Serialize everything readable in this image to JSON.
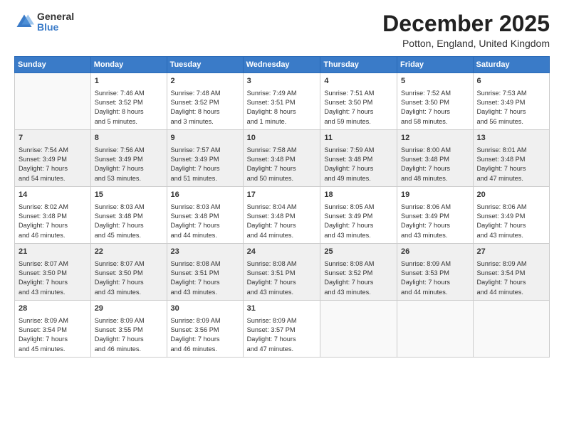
{
  "logo": {
    "general": "General",
    "blue": "Blue"
  },
  "title": "December 2025",
  "location": "Potton, England, United Kingdom",
  "headers": [
    "Sunday",
    "Monday",
    "Tuesday",
    "Wednesday",
    "Thursday",
    "Friday",
    "Saturday"
  ],
  "weeks": [
    [
      {
        "day": "",
        "info": ""
      },
      {
        "day": "1",
        "info": "Sunrise: 7:46 AM\nSunset: 3:52 PM\nDaylight: 8 hours\nand 5 minutes."
      },
      {
        "day": "2",
        "info": "Sunrise: 7:48 AM\nSunset: 3:52 PM\nDaylight: 8 hours\nand 3 minutes."
      },
      {
        "day": "3",
        "info": "Sunrise: 7:49 AM\nSunset: 3:51 PM\nDaylight: 8 hours\nand 1 minute."
      },
      {
        "day": "4",
        "info": "Sunrise: 7:51 AM\nSunset: 3:50 PM\nDaylight: 7 hours\nand 59 minutes."
      },
      {
        "day": "5",
        "info": "Sunrise: 7:52 AM\nSunset: 3:50 PM\nDaylight: 7 hours\nand 58 minutes."
      },
      {
        "day": "6",
        "info": "Sunrise: 7:53 AM\nSunset: 3:49 PM\nDaylight: 7 hours\nand 56 minutes."
      }
    ],
    [
      {
        "day": "7",
        "info": "Sunrise: 7:54 AM\nSunset: 3:49 PM\nDaylight: 7 hours\nand 54 minutes."
      },
      {
        "day": "8",
        "info": "Sunrise: 7:56 AM\nSunset: 3:49 PM\nDaylight: 7 hours\nand 53 minutes."
      },
      {
        "day": "9",
        "info": "Sunrise: 7:57 AM\nSunset: 3:49 PM\nDaylight: 7 hours\nand 51 minutes."
      },
      {
        "day": "10",
        "info": "Sunrise: 7:58 AM\nSunset: 3:48 PM\nDaylight: 7 hours\nand 50 minutes."
      },
      {
        "day": "11",
        "info": "Sunrise: 7:59 AM\nSunset: 3:48 PM\nDaylight: 7 hours\nand 49 minutes."
      },
      {
        "day": "12",
        "info": "Sunrise: 8:00 AM\nSunset: 3:48 PM\nDaylight: 7 hours\nand 48 minutes."
      },
      {
        "day": "13",
        "info": "Sunrise: 8:01 AM\nSunset: 3:48 PM\nDaylight: 7 hours\nand 47 minutes."
      }
    ],
    [
      {
        "day": "14",
        "info": "Sunrise: 8:02 AM\nSunset: 3:48 PM\nDaylight: 7 hours\nand 46 minutes."
      },
      {
        "day": "15",
        "info": "Sunrise: 8:03 AM\nSunset: 3:48 PM\nDaylight: 7 hours\nand 45 minutes."
      },
      {
        "day": "16",
        "info": "Sunrise: 8:03 AM\nSunset: 3:48 PM\nDaylight: 7 hours\nand 44 minutes."
      },
      {
        "day": "17",
        "info": "Sunrise: 8:04 AM\nSunset: 3:48 PM\nDaylight: 7 hours\nand 44 minutes."
      },
      {
        "day": "18",
        "info": "Sunrise: 8:05 AM\nSunset: 3:49 PM\nDaylight: 7 hours\nand 43 minutes."
      },
      {
        "day": "19",
        "info": "Sunrise: 8:06 AM\nSunset: 3:49 PM\nDaylight: 7 hours\nand 43 minutes."
      },
      {
        "day": "20",
        "info": "Sunrise: 8:06 AM\nSunset: 3:49 PM\nDaylight: 7 hours\nand 43 minutes."
      }
    ],
    [
      {
        "day": "21",
        "info": "Sunrise: 8:07 AM\nSunset: 3:50 PM\nDaylight: 7 hours\nand 43 minutes."
      },
      {
        "day": "22",
        "info": "Sunrise: 8:07 AM\nSunset: 3:50 PM\nDaylight: 7 hours\nand 43 minutes."
      },
      {
        "day": "23",
        "info": "Sunrise: 8:08 AM\nSunset: 3:51 PM\nDaylight: 7 hours\nand 43 minutes."
      },
      {
        "day": "24",
        "info": "Sunrise: 8:08 AM\nSunset: 3:51 PM\nDaylight: 7 hours\nand 43 minutes."
      },
      {
        "day": "25",
        "info": "Sunrise: 8:08 AM\nSunset: 3:52 PM\nDaylight: 7 hours\nand 43 minutes."
      },
      {
        "day": "26",
        "info": "Sunrise: 8:09 AM\nSunset: 3:53 PM\nDaylight: 7 hours\nand 44 minutes."
      },
      {
        "day": "27",
        "info": "Sunrise: 8:09 AM\nSunset: 3:54 PM\nDaylight: 7 hours\nand 44 minutes."
      }
    ],
    [
      {
        "day": "28",
        "info": "Sunrise: 8:09 AM\nSunset: 3:54 PM\nDaylight: 7 hours\nand 45 minutes."
      },
      {
        "day": "29",
        "info": "Sunrise: 8:09 AM\nSunset: 3:55 PM\nDaylight: 7 hours\nand 46 minutes."
      },
      {
        "day": "30",
        "info": "Sunrise: 8:09 AM\nSunset: 3:56 PM\nDaylight: 7 hours\nand 46 minutes."
      },
      {
        "day": "31",
        "info": "Sunrise: 8:09 AM\nSunset: 3:57 PM\nDaylight: 7 hours\nand 47 minutes."
      },
      {
        "day": "",
        "info": ""
      },
      {
        "day": "",
        "info": ""
      },
      {
        "day": "",
        "info": ""
      }
    ]
  ]
}
